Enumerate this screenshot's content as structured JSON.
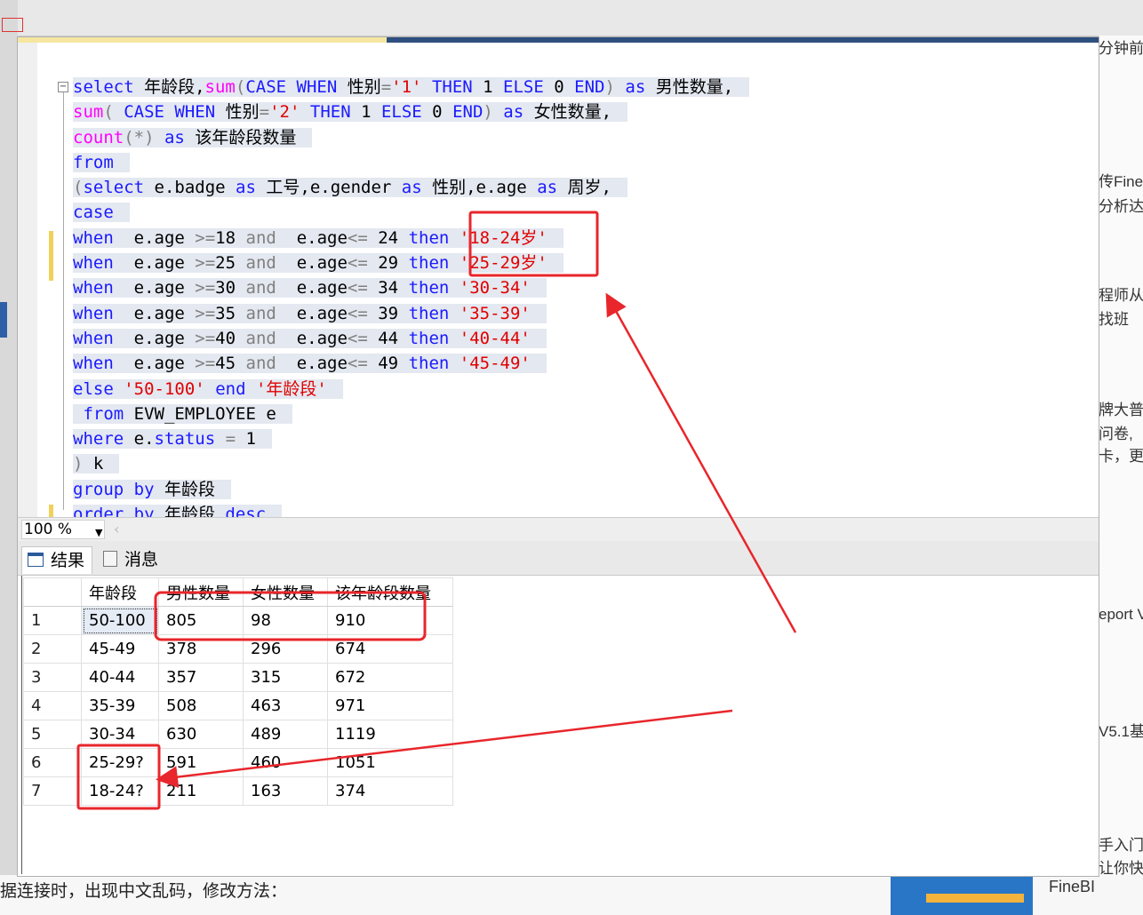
{
  "background": {
    "side_texts": [
      "分钟前",
      "传FineI",
      "分析达",
      "程师从",
      "找班",
      "牌大普",
      "问卷,",
      "卡，更",
      "eport V",
      "V5.1基",
      "手入门",
      "让你快"
    ],
    "bottom_text": "据连接时，出现中文乱码，修改方法：",
    "finebi_label": "FineBI"
  },
  "editor": {
    "lines": [
      [
        [
          "k",
          "select"
        ],
        [
          "t",
          " 年龄段,"
        ],
        [
          "f",
          "sum"
        ],
        [
          "g",
          "("
        ],
        [
          "k",
          "CASE WHEN"
        ],
        [
          "t",
          " 性别"
        ],
        [
          "g",
          "="
        ],
        [
          "s",
          "'1'"
        ],
        [
          "t",
          " "
        ],
        [
          "k",
          "THEN"
        ],
        [
          "t",
          " 1 "
        ],
        [
          "k",
          "ELSE"
        ],
        [
          "t",
          " 0 "
        ],
        [
          "k",
          "END"
        ],
        [
          "g",
          ")"
        ],
        [
          "t",
          " "
        ],
        [
          "k",
          "as"
        ],
        [
          "t",
          " 男性数量,"
        ]
      ],
      [
        [
          "f",
          "sum"
        ],
        [
          "g",
          "("
        ],
        [
          "t",
          " "
        ],
        [
          "k",
          "CASE WHEN"
        ],
        [
          "t",
          " 性别"
        ],
        [
          "g",
          "="
        ],
        [
          "s",
          "'2'"
        ],
        [
          "t",
          " "
        ],
        [
          "k",
          "THEN"
        ],
        [
          "t",
          " 1 "
        ],
        [
          "k",
          "ELSE"
        ],
        [
          "t",
          " 0 "
        ],
        [
          "k",
          "END"
        ],
        [
          "g",
          ")"
        ],
        [
          "t",
          " "
        ],
        [
          "k",
          "as"
        ],
        [
          "t",
          " 女性数量,"
        ]
      ],
      [
        [
          "f",
          "count"
        ],
        [
          "g",
          "(*)"
        ],
        [
          "t",
          " "
        ],
        [
          "k",
          "as"
        ],
        [
          "t",
          " 该年龄段数量"
        ]
      ],
      [
        [
          "k",
          "from"
        ]
      ],
      [
        [
          "g",
          "("
        ],
        [
          "k",
          "select"
        ],
        [
          "t",
          " e.badge "
        ],
        [
          "k",
          "as"
        ],
        [
          "t",
          " 工号,e.gender "
        ],
        [
          "k",
          "as"
        ],
        [
          "t",
          " 性别,e.age "
        ],
        [
          "k",
          "as"
        ],
        [
          "t",
          " 周岁,"
        ]
      ],
      [
        [
          "k",
          "case"
        ]
      ],
      [
        [
          "k",
          "when"
        ],
        [
          "t",
          "  e.age "
        ],
        [
          "g",
          ">="
        ],
        [
          "t",
          "18 "
        ],
        [
          "g",
          "and"
        ],
        [
          "t",
          "  e.age"
        ],
        [
          "g",
          "<="
        ],
        [
          "t",
          " 24 "
        ],
        [
          "k",
          "then"
        ],
        [
          "t",
          " "
        ],
        [
          "s",
          "'18-24岁'"
        ]
      ],
      [
        [
          "k",
          "when"
        ],
        [
          "t",
          "  e.age "
        ],
        [
          "g",
          ">="
        ],
        [
          "t",
          "25 "
        ],
        [
          "g",
          "and"
        ],
        [
          "t",
          "  e.age"
        ],
        [
          "g",
          "<="
        ],
        [
          "t",
          " 29 "
        ],
        [
          "k",
          "then"
        ],
        [
          "t",
          " "
        ],
        [
          "s",
          "'25-29岁'"
        ]
      ],
      [
        [
          "k",
          "when"
        ],
        [
          "t",
          "  e.age "
        ],
        [
          "g",
          ">="
        ],
        [
          "t",
          "30 "
        ],
        [
          "g",
          "and"
        ],
        [
          "t",
          "  e.age"
        ],
        [
          "g",
          "<="
        ],
        [
          "t",
          " 34 "
        ],
        [
          "k",
          "then"
        ],
        [
          "t",
          " "
        ],
        [
          "s",
          "'30-34'"
        ]
      ],
      [
        [
          "k",
          "when"
        ],
        [
          "t",
          "  e.age "
        ],
        [
          "g",
          ">="
        ],
        [
          "t",
          "35 "
        ],
        [
          "g",
          "and"
        ],
        [
          "t",
          "  e.age"
        ],
        [
          "g",
          "<="
        ],
        [
          "t",
          " 39 "
        ],
        [
          "k",
          "then"
        ],
        [
          "t",
          " "
        ],
        [
          "s",
          "'35-39'"
        ]
      ],
      [
        [
          "k",
          "when"
        ],
        [
          "t",
          "  e.age "
        ],
        [
          "g",
          ">="
        ],
        [
          "t",
          "40 "
        ],
        [
          "g",
          "and"
        ],
        [
          "t",
          "  e.age"
        ],
        [
          "g",
          "<="
        ],
        [
          "t",
          " 44 "
        ],
        [
          "k",
          "then"
        ],
        [
          "t",
          " "
        ],
        [
          "s",
          "'40-44'"
        ]
      ],
      [
        [
          "k",
          "when"
        ],
        [
          "t",
          "  e.age "
        ],
        [
          "g",
          ">="
        ],
        [
          "t",
          "45 "
        ],
        [
          "g",
          "and"
        ],
        [
          "t",
          "  e.age"
        ],
        [
          "g",
          "<="
        ],
        [
          "t",
          " 49 "
        ],
        [
          "k",
          "then"
        ],
        [
          "t",
          " "
        ],
        [
          "s",
          "'45-49'"
        ]
      ],
      [
        [
          "k",
          "else"
        ],
        [
          "t",
          " "
        ],
        [
          "s",
          "'50-100'"
        ],
        [
          "t",
          " "
        ],
        [
          "k",
          "end"
        ],
        [
          "t",
          " "
        ],
        [
          "s",
          "'年龄段'"
        ]
      ],
      [
        [
          "t",
          " "
        ],
        [
          "k",
          "from"
        ],
        [
          "t",
          " EVW_EMPLOYEE e"
        ]
      ],
      [
        [
          "k",
          "where"
        ],
        [
          "t",
          " e."
        ],
        [
          "k",
          "status"
        ],
        [
          "t",
          " "
        ],
        [
          "g",
          "="
        ],
        [
          "t",
          " 1"
        ]
      ],
      [
        [
          "g",
          ")"
        ],
        [
          "t",
          " k"
        ]
      ],
      [
        [
          "k",
          "group by"
        ],
        [
          "t",
          " 年龄段"
        ]
      ],
      [
        [
          "k",
          "order by"
        ],
        [
          "t",
          " 年龄段 "
        ],
        [
          "k",
          "desc"
        ]
      ]
    ]
  },
  "zoom": {
    "value": "100 %"
  },
  "result_tabs": {
    "results": "结果",
    "messages": "消息"
  },
  "results": {
    "columns": [
      "年龄段",
      "男性数量",
      "女性数量",
      "该年龄段数量"
    ],
    "rows": [
      [
        "1",
        "50-100",
        "805",
        "98",
        "910"
      ],
      [
        "2",
        "45-49",
        "378",
        "296",
        "674"
      ],
      [
        "3",
        "40-44",
        "357",
        "315",
        "672"
      ],
      [
        "4",
        "35-39",
        "508",
        "463",
        "971"
      ],
      [
        "5",
        "30-34",
        "630",
        "489",
        "1119"
      ],
      [
        "6",
        "25-29?",
        "591",
        "460",
        "1051"
      ],
      [
        "7",
        "18-24?",
        "211",
        "163",
        "374"
      ]
    ]
  },
  "annotation_color": "#e8262b"
}
